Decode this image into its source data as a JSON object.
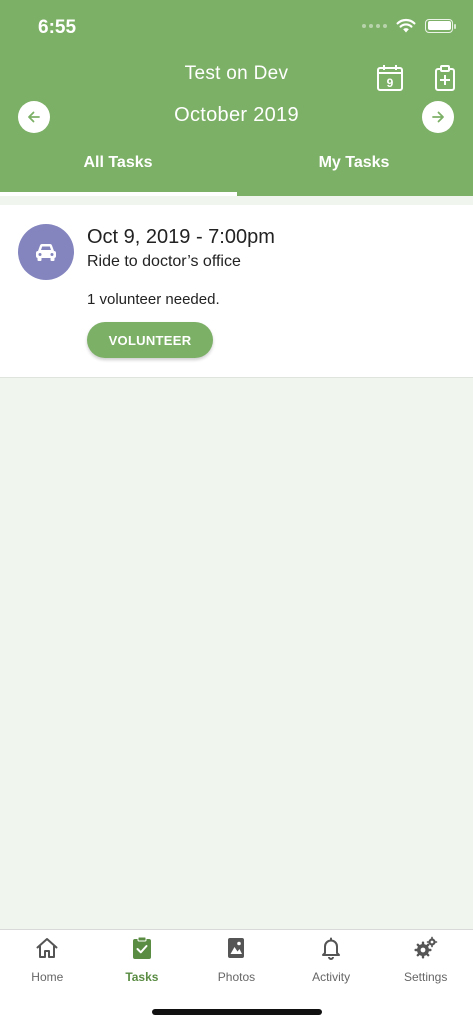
{
  "status": {
    "time": "6:55"
  },
  "header": {
    "title": "Test on Dev",
    "month": "October 2019",
    "calendar_day": "9",
    "tabs": [
      {
        "label": "All Tasks",
        "active": true
      },
      {
        "label": "My Tasks",
        "active": false
      }
    ]
  },
  "tasks": [
    {
      "date": "Oct 9, 2019 - 7:00pm",
      "title": "Ride to doctor’s office",
      "need": "1 volunteer needed.",
      "button": "VOLUNTEER",
      "icon": "car-icon"
    }
  ],
  "tabbar": {
    "items": [
      {
        "label": "Home",
        "icon": "home-icon",
        "active": false
      },
      {
        "label": "Tasks",
        "icon": "tasks-icon",
        "active": true
      },
      {
        "label": "Photos",
        "icon": "photos-icon",
        "active": false
      },
      {
        "label": "Activity",
        "icon": "bell-icon",
        "active": false
      },
      {
        "label": "Settings",
        "icon": "settings-icon",
        "active": false
      }
    ]
  },
  "colors": {
    "brand_green": "#7db067",
    "active_green": "#5a8c43",
    "avatar_purple": "#8485bf",
    "background": "#f0f5ee"
  }
}
